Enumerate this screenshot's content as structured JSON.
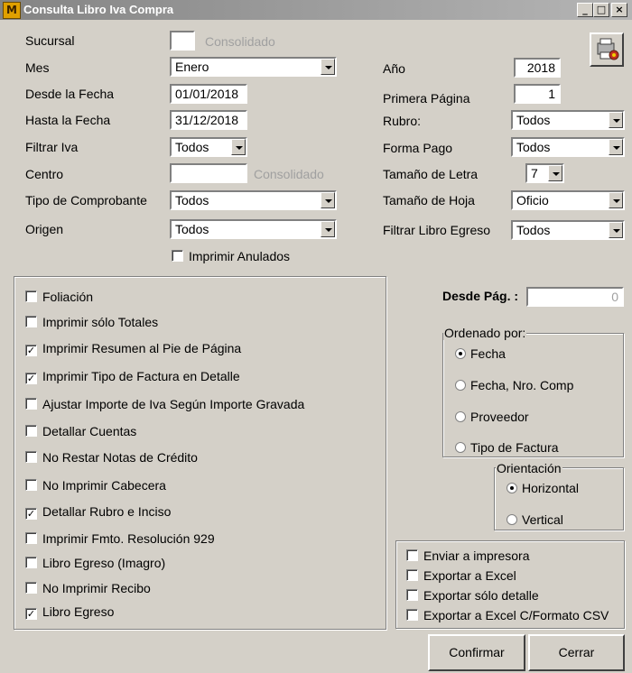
{
  "window": {
    "title": "Consulta Libro Iva Compra",
    "app_icon": "M"
  },
  "left_form": {
    "sucursal": {
      "label": "Sucursal",
      "hint": "Consolidado"
    },
    "mes": {
      "label": "Mes",
      "value": "Enero"
    },
    "desde_fecha": {
      "label": "Desde la Fecha",
      "value": "01/01/2018"
    },
    "hasta_fecha": {
      "label": "Hasta la Fecha",
      "value": "31/12/2018"
    },
    "filtrar_iva": {
      "label": "Filtrar Iva",
      "value": "Todos"
    },
    "centro": {
      "label": "Centro",
      "hint": "Consolidado"
    },
    "tipo_comprobante": {
      "label": "Tipo de Comprobante",
      "value": "Todos"
    },
    "origen": {
      "label": "Origen",
      "value": "Todos"
    },
    "imprimir_anulados": {
      "label": "Imprimir Anulados",
      "checked": false
    }
  },
  "right_form": {
    "anio": {
      "label": "Año",
      "value": "2018"
    },
    "primera_pagina": {
      "label": "Primera Página",
      "value": "1"
    },
    "rubro": {
      "label": "Rubro:",
      "value": "Todos"
    },
    "forma_pago": {
      "label": "Forma Pago",
      "value": "Todos"
    },
    "tamano_letra": {
      "label": "Tamaño de Letra",
      "value": "7"
    },
    "tamano_hoja": {
      "label": "Tamaño de Hoja",
      "value": "Oficio"
    },
    "filtrar_libro_egreso": {
      "label": "Filtrar Libro Egreso",
      "value": "Todos"
    }
  },
  "options": [
    {
      "label": "Foliación",
      "checked": false
    },
    {
      "label": "Imprimir sólo Totales",
      "checked": false
    },
    {
      "label": "Imprimir Resumen al Pie de Página",
      "checked": true
    },
    {
      "label": "Imprimir Tipo de Factura en Detalle",
      "checked": true
    },
    {
      "label": "Ajustar Importe de Iva Según Importe Gravada",
      "checked": false
    },
    {
      "label": "Detallar Cuentas",
      "checked": false
    },
    {
      "label": "No Restar Notas de Crédito",
      "checked": false
    },
    {
      "label": "No Imprimir Cabecera",
      "checked": false
    },
    {
      "label": "Detallar Rubro e Inciso",
      "checked": true
    },
    {
      "label": "Imprimir Fmto. Resolución 929",
      "checked": false
    },
    {
      "label": "Libro Egreso (Imagro)",
      "checked": false
    },
    {
      "label": "No Imprimir Recibo",
      "checked": false
    },
    {
      "label": "Libro Egreso",
      "checked": true
    }
  ],
  "desde_pag": {
    "label": "Desde Pág. :",
    "value": "0"
  },
  "ordenado_por": {
    "title": "Ordenado por:",
    "options": [
      {
        "label": "Fecha",
        "selected": true
      },
      {
        "label": "Fecha, Nro. Comp",
        "selected": false
      },
      {
        "label": "Proveedor",
        "selected": false
      },
      {
        "label": "Tipo de Factura",
        "selected": false
      }
    ]
  },
  "orientacion": {
    "title": "Orientación",
    "options": [
      {
        "label": "Horizontal",
        "selected": true
      },
      {
        "label": "Vertical",
        "selected": false
      }
    ]
  },
  "output_options": [
    {
      "label": "Enviar a impresora",
      "checked": false
    },
    {
      "label": "Exportar a Excel",
      "checked": false
    },
    {
      "label": "Exportar sólo detalle",
      "checked": false
    },
    {
      "label": "Exportar a Excel C/Formato CSV",
      "checked": false
    }
  ],
  "buttons": {
    "confirmar": "Confirmar",
    "cerrar": "Cerrar"
  }
}
